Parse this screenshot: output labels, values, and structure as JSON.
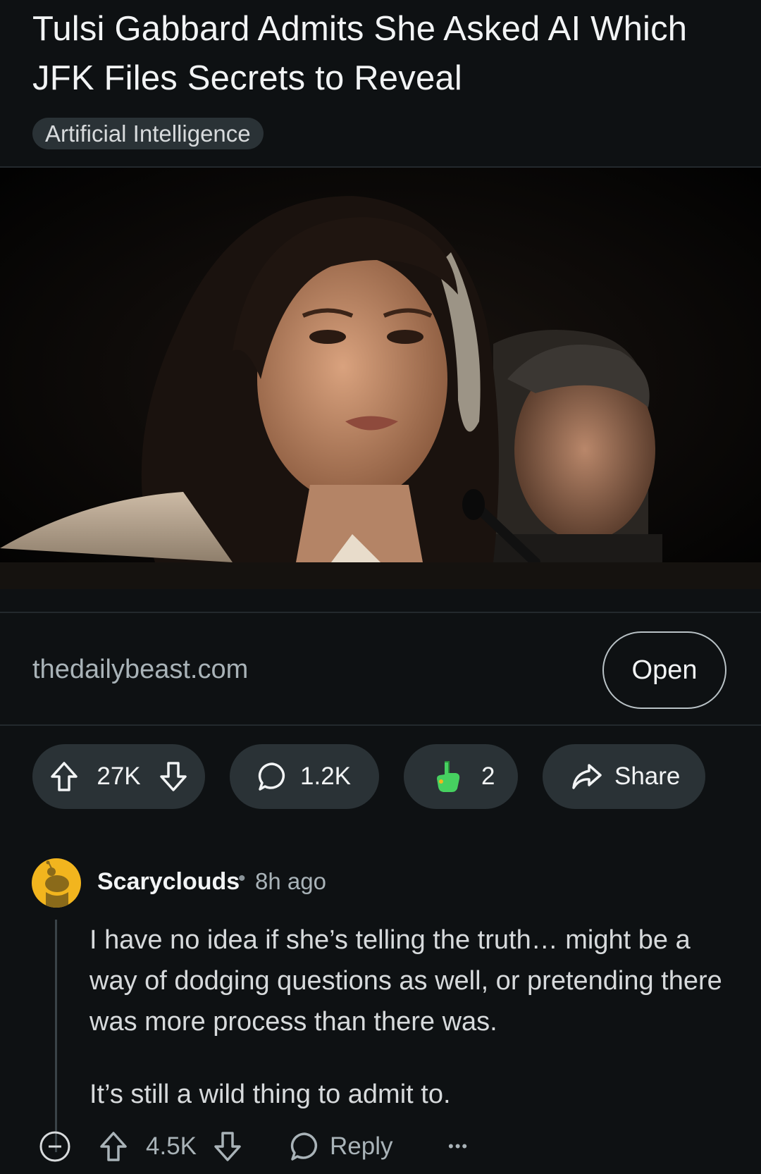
{
  "post": {
    "title": "Tulsi Gabbard Admits She Asked AI Which JFK Files Secrets to Reveal",
    "flair": "Artificial Intelligence",
    "link_domain": "thedailybeast.com",
    "open_label": "Open",
    "votes": "27K",
    "comments": "1.2K",
    "awards": "2",
    "share_label": "Share"
  },
  "comment": {
    "author": "Scaryclouds",
    "separator": "•",
    "time": "8h ago",
    "paragraphs": [
      "I have no idea if she’s telling the truth… might be a way of dodging questions as well, or pretending there was more process than there was.",
      "It’s still a wild thing to admit to."
    ],
    "votes": "4.5K",
    "reply_label": "Reply",
    "more_label": "•••"
  },
  "colors": {
    "background": "#0e1113",
    "pill": "#2a3236",
    "avatar": "#f2b51e",
    "award_green": "#46d160"
  },
  "icons": [
    "upvote-icon",
    "downvote-icon",
    "comment-bubble-icon",
    "award-hand-icon",
    "share-arrow-icon",
    "collapse-icon",
    "reply-bubble-icon",
    "more-options-icon",
    "snoo-avatar-icon"
  ]
}
